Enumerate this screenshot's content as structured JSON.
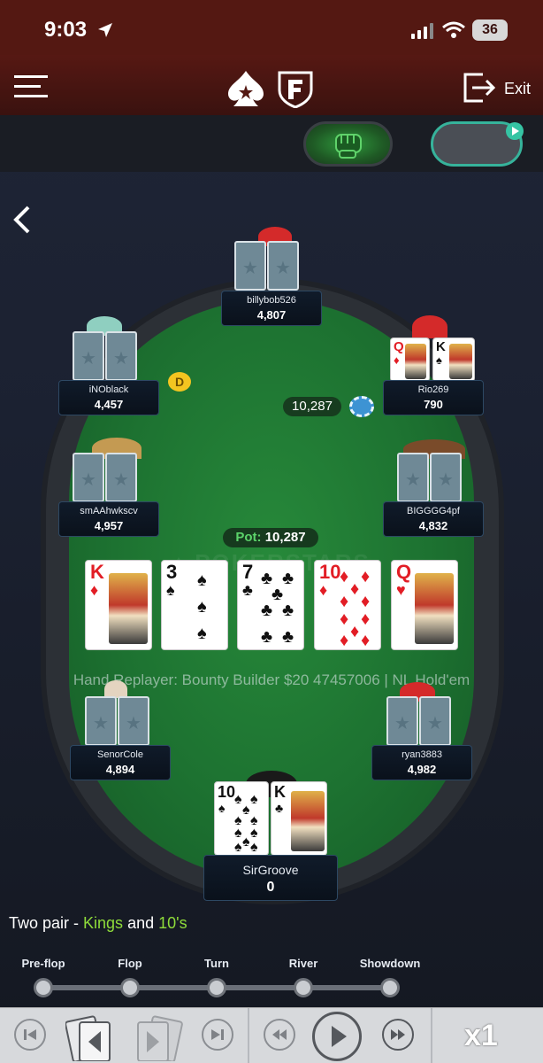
{
  "status": {
    "time": "9:03",
    "battery": "36"
  },
  "header": {
    "exit_label": "Exit"
  },
  "players": [
    {
      "name": "billybob526",
      "stack": "4,807"
    },
    {
      "name": "iNOblack",
      "stack": "4,457"
    },
    {
      "name": "Rio269",
      "stack": "790"
    },
    {
      "name": "smAAhwkscv",
      "stack": "4,957"
    },
    {
      "name": "BIGGGG4pf",
      "stack": "4,832"
    },
    {
      "name": "SenorCole",
      "stack": "4,894"
    },
    {
      "name": "ryan3883",
      "stack": "4,982"
    },
    {
      "name": "SirGroove",
      "stack": "0"
    }
  ],
  "dealer_label": "D",
  "bet_amount": "10,287",
  "pot": {
    "label": "Pot:",
    "value": "10,287"
  },
  "board": [
    {
      "rank": "K",
      "suit": "♦"
    },
    {
      "rank": "3",
      "suit": "♠"
    },
    {
      "rank": "7",
      "suit": "♣"
    },
    {
      "rank": "10",
      "suit": "♦"
    },
    {
      "rank": "Q",
      "suit": "♥"
    }
  ],
  "rio_cards": [
    {
      "rank": "Q",
      "suit": "♦"
    },
    {
      "rank": "K",
      "suit": "♠"
    }
  ],
  "hero_cards": [
    {
      "rank": "10",
      "suit": "♠"
    },
    {
      "rank": "K",
      "suit": "♣"
    }
  ],
  "replayer_text": "Hand Replayer: Bounty Builder $20 47457006 | NL Hold'em",
  "hand_description": {
    "prefix": "Two pair - ",
    "first": "Kings",
    "middle": " and ",
    "second": "10's"
  },
  "timeline": {
    "phases": [
      "Pre-flop",
      "Flop",
      "Turn",
      "River",
      "Showdown"
    ]
  },
  "speed_label": "x1"
}
